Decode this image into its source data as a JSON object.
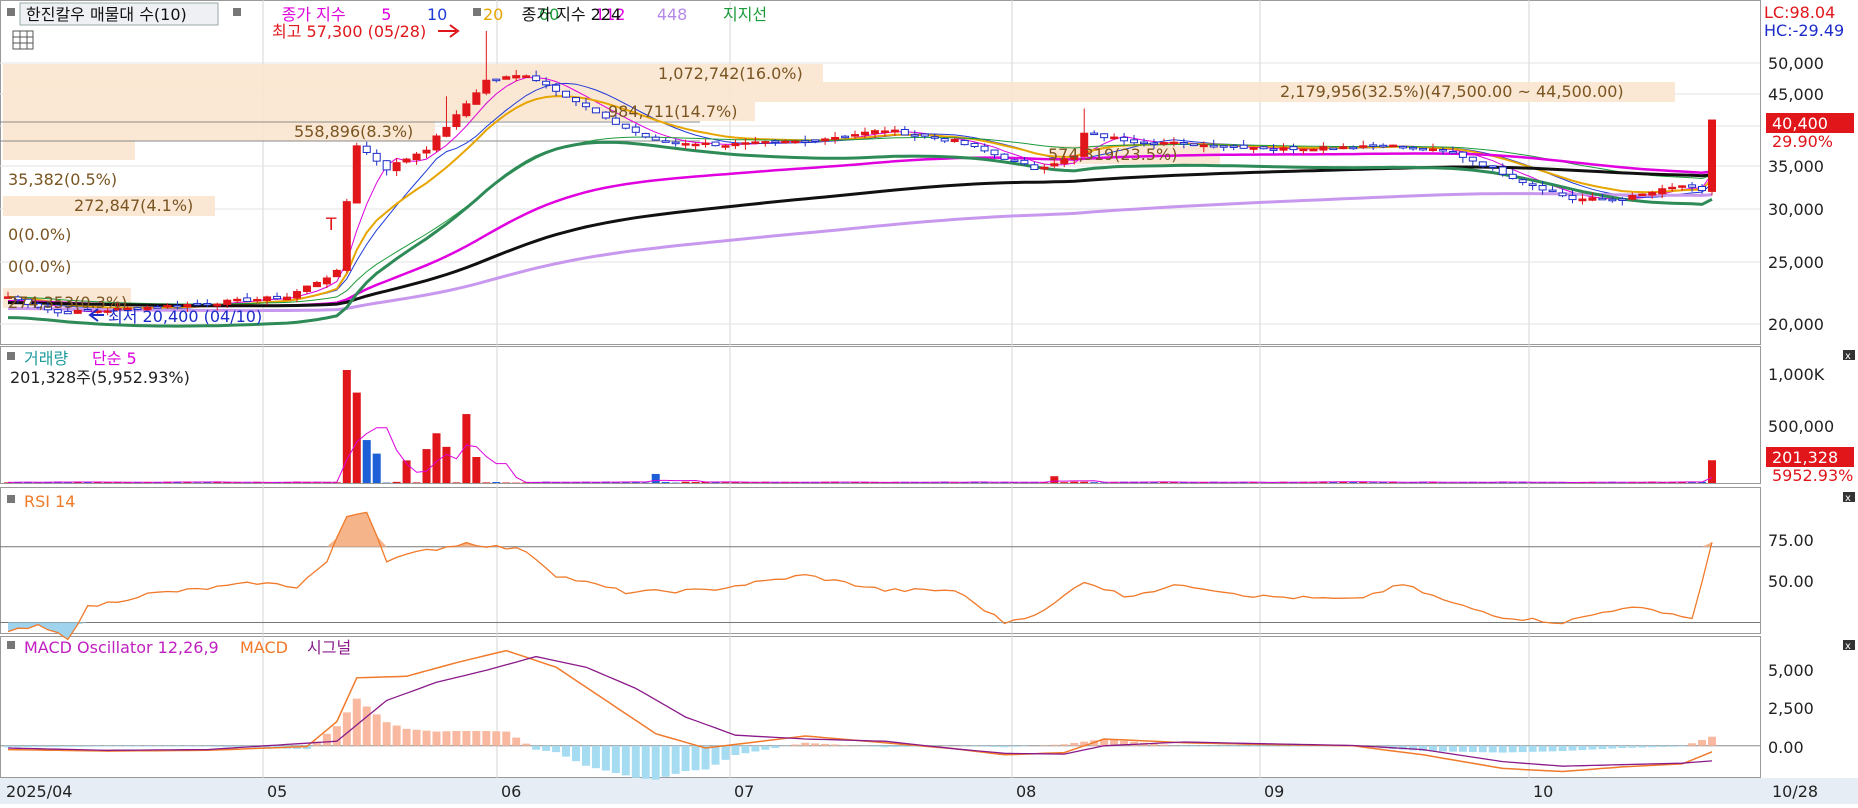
{
  "header": {
    "title": "한진칼우 매물대 수(10)",
    "ma_title": "종가 지수",
    "ma_periods": [
      "5",
      "10",
      "20",
      "60",
      "112"
    ],
    "ma_colors": [
      "#dd00dd",
      "#1f3bd6",
      "#e7a500",
      "#1c9b3a",
      "#e000e0"
    ],
    "ma2_title": "종가 지수 224",
    "ma2_extra": "448",
    "support": "지지선"
  },
  "lc_hc": {
    "lc": "LC:98.04",
    "hc": "HC:-29.49"
  },
  "price_axis": {
    "ticks": [
      "50,000",
      "45,000",
      "40,000",
      "35,000",
      "30,000",
      "25,000",
      "20,000"
    ],
    "last_price": "40,400",
    "last_pct": "29.90%"
  },
  "volume_profile": [
    {
      "label": "1,072,742(16.0%)"
    },
    {
      "label": "2,179,956(32.5%)(47,500.00 ~ 44,500.00)"
    },
    {
      "label": "984,711(14.7%)"
    },
    {
      "label": "558,896(8.3%)"
    },
    {
      "label": "35,382(0.5%)"
    },
    {
      "label": "272,847(4.1%)"
    },
    {
      "label": "0(0.0%)"
    },
    {
      "label": "0(0.0%)"
    },
    {
      "label": "274,353(0.3%)"
    },
    {
      "label": "574,319(23.5%)"
    }
  ],
  "annotations": {
    "high": "최고 57,300 (05/28)",
    "low": "최저 20,400 (04/10)",
    "marker": "T"
  },
  "volume_panel": {
    "title": "거래량",
    "ma": "단순 5",
    "info": "201,328주(5,952.93%)",
    "ticks": [
      "1,000K",
      "500,000"
    ],
    "last_vol": "201,328",
    "last_pct": "5952.93%"
  },
  "rsi_panel": {
    "title": "RSI 14",
    "ticks": [
      "75.00",
      "50.00"
    ]
  },
  "macd_panel": {
    "title": "MACD Oscillator 12,26,9",
    "macd": "MACD",
    "signal": "시그널",
    "ticks": [
      "5,000",
      "2,500",
      "0.00"
    ]
  },
  "x_axis": {
    "labels": [
      "2025/04",
      "05",
      "06",
      "07",
      "08",
      "09",
      "10"
    ],
    "end_label": "10/28"
  },
  "chart_data": {
    "type": "candlestick",
    "months": [
      "2025/04",
      "05",
      "06",
      "07",
      "08",
      "09",
      "10"
    ],
    "close_keypoints": [
      [
        0,
        22000
      ],
      [
        5,
        20800
      ],
      [
        10,
        21000
      ],
      [
        20,
        21500
      ],
      [
        28,
        22000
      ],
      [
        33,
        24000
      ],
      [
        35,
        37500
      ],
      [
        38,
        34500
      ],
      [
        42,
        37000
      ],
      [
        45,
        41500
      ],
      [
        48,
        47000
      ],
      [
        52,
        48000
      ],
      [
        55,
        45500
      ],
      [
        60,
        41000
      ],
      [
        65,
        38000
      ],
      [
        72,
        37500
      ],
      [
        80,
        38000
      ],
      [
        88,
        39500
      ],
      [
        95,
        38000
      ],
      [
        103,
        34500
      ],
      [
        107,
        36000
      ],
      [
        108,
        39000
      ],
      [
        113,
        38000
      ],
      [
        120,
        37500
      ],
      [
        128,
        37000
      ],
      [
        138,
        37500
      ],
      [
        145,
        36500
      ],
      [
        152,
        33000
      ],
      [
        157,
        31000
      ],
      [
        162,
        31000
      ],
      [
        168,
        32500
      ],
      [
        170,
        31800
      ],
      [
        171,
        40400
      ]
    ],
    "highlights": {
      "high": {
        "value": 57300,
        "date": "05/28"
      },
      "low": {
        "value": 20400,
        "date": "04/10"
      }
    },
    "volume_spikes": [
      [
        34,
        1000000
      ],
      [
        35,
        800000
      ],
      [
        36,
        380000
      ],
      [
        37,
        260000
      ],
      [
        40,
        200000
      ],
      [
        42,
        300000
      ],
      [
        43,
        440000
      ],
      [
        44,
        320000
      ],
      [
        46,
        610000
      ],
      [
        47,
        230000
      ],
      [
        65,
        80000
      ],
      [
        105,
        60000
      ],
      [
        171,
        201328
      ]
    ],
    "rsi_keypoints": [
      [
        0,
        25
      ],
      [
        3,
        28
      ],
      [
        6,
        22
      ],
      [
        8,
        38
      ],
      [
        14,
        45
      ],
      [
        20,
        48
      ],
      [
        25,
        51
      ],
      [
        29,
        49
      ],
      [
        32,
        62
      ],
      [
        34,
        86
      ],
      [
        36,
        89
      ],
      [
        38,
        63
      ],
      [
        42,
        68
      ],
      [
        46,
        72
      ],
      [
        49,
        70
      ],
      [
        52,
        68
      ],
      [
        55,
        55
      ],
      [
        62,
        46
      ],
      [
        70,
        47
      ],
      [
        80,
        55
      ],
      [
        88,
        47
      ],
      [
        95,
        47
      ],
      [
        100,
        30
      ],
      [
        104,
        36
      ],
      [
        108,
        52
      ],
      [
        112,
        44
      ],
      [
        118,
        50
      ],
      [
        125,
        44
      ],
      [
        135,
        42
      ],
      [
        140,
        50
      ],
      [
        145,
        40
      ],
      [
        150,
        33
      ],
      [
        156,
        30
      ],
      [
        162,
        38
      ],
      [
        166,
        36
      ],
      [
        169,
        32
      ],
      [
        171,
        72
      ]
    ],
    "macd_keypoints": [
      [
        0,
        -250
      ],
      [
        10,
        -350
      ],
      [
        20,
        -300
      ],
      [
        30,
        -50
      ],
      [
        33,
        1600
      ],
      [
        35,
        4500
      ],
      [
        40,
        4600
      ],
      [
        45,
        5500
      ],
      [
        50,
        6300
      ],
      [
        55,
        5200
      ],
      [
        60,
        3000
      ],
      [
        65,
        800
      ],
      [
        70,
        -150
      ],
      [
        80,
        650
      ],
      [
        88,
        200
      ],
      [
        95,
        -200
      ],
      [
        100,
        -600
      ],
      [
        106,
        -450
      ],
      [
        110,
        450
      ],
      [
        118,
        200
      ],
      [
        125,
        100
      ],
      [
        135,
        0
      ],
      [
        142,
        -600
      ],
      [
        150,
        -1500
      ],
      [
        156,
        -1700
      ],
      [
        162,
        -1400
      ],
      [
        168,
        -1200
      ],
      [
        171,
        -400
      ]
    ],
    "signal_keypoints": [
      [
        0,
        -150
      ],
      [
        10,
        -300
      ],
      [
        20,
        -250
      ],
      [
        33,
        300
      ],
      [
        38,
        3000
      ],
      [
        43,
        4200
      ],
      [
        48,
        5000
      ],
      [
        53,
        5900
      ],
      [
        58,
        5200
      ],
      [
        63,
        3800
      ],
      [
        68,
        1900
      ],
      [
        73,
        700
      ],
      [
        80,
        450
      ],
      [
        88,
        300
      ],
      [
        95,
        -200
      ],
      [
        100,
        -500
      ],
      [
        106,
        -550
      ],
      [
        110,
        0
      ],
      [
        118,
        250
      ],
      [
        125,
        150
      ],
      [
        135,
        20
      ],
      [
        142,
        -250
      ],
      [
        150,
        -1050
      ],
      [
        156,
        -1350
      ],
      [
        162,
        -1250
      ],
      [
        168,
        -1150
      ],
      [
        171,
        -1000
      ]
    ],
    "price_range": [
      18000,
      57300
    ],
    "volume_max": 1000000,
    "rsi_range": [
      25,
      100
    ],
    "macd_range": [
      -2000,
      7000
    ]
  }
}
